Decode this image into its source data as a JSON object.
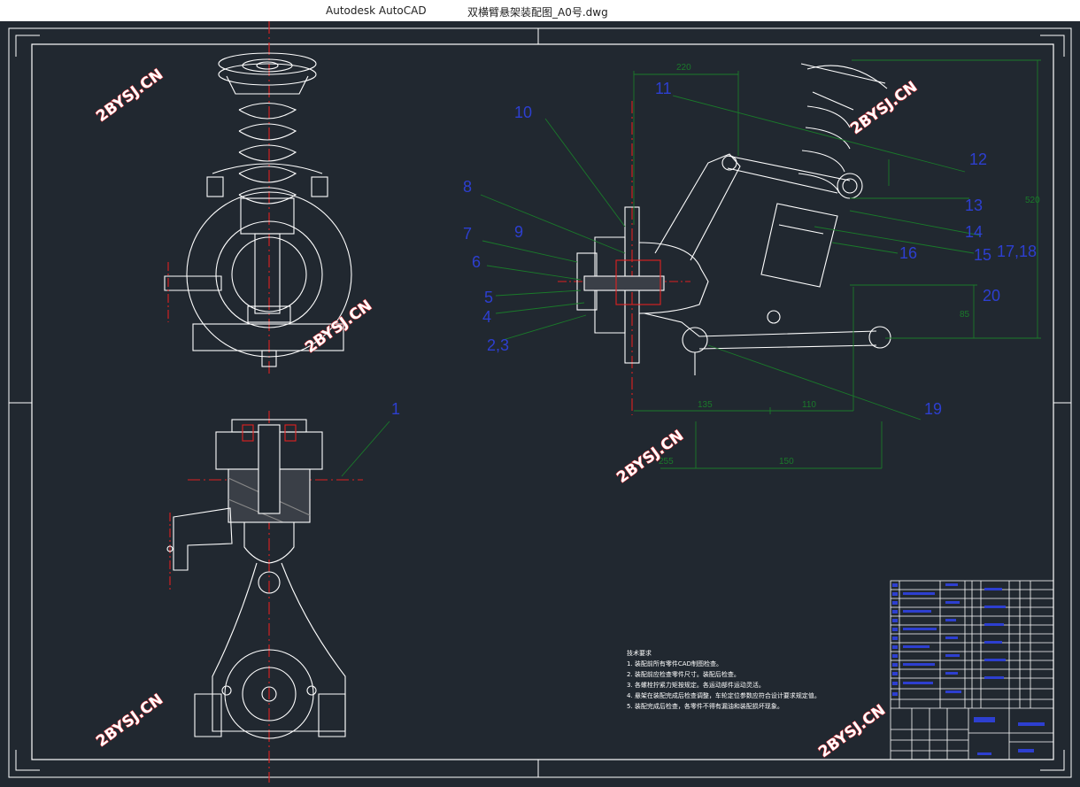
{
  "titlebar": {
    "app_name": "Autodesk AutoCAD",
    "file_name": "双横臂悬架装配图_A0号.dwg"
  },
  "watermark": "2BYSJ.CN",
  "part_labels": [
    "1",
    "2,3",
    "4",
    "5",
    "6",
    "7",
    "8",
    "9",
    "10",
    "11",
    "12",
    "13",
    "14",
    "15",
    "16",
    "17,18",
    "19",
    "20"
  ],
  "notes": {
    "heading": "技术要求",
    "items": [
      "1.  装配前所有零件CAD制图检查。",
      "2.  装配前应检查零件尺寸。装配后检查。",
      "3.  各螺栓拧紧力矩按规定。各运动部件运动灵活。",
      "4.  悬架在装配完成后检查调整，车轮定位参数应符合设计要求规定值。",
      "5.  装配完成后检查，各零件不得有漏油和装配损坏现象。"
    ]
  },
  "colors": {
    "background": "#212830",
    "lines": "#ffffff",
    "center_lines": "#e02020",
    "labels": "#2d3fd0",
    "dimensions": "#1a7a2a",
    "watermark": "#e2262b"
  }
}
